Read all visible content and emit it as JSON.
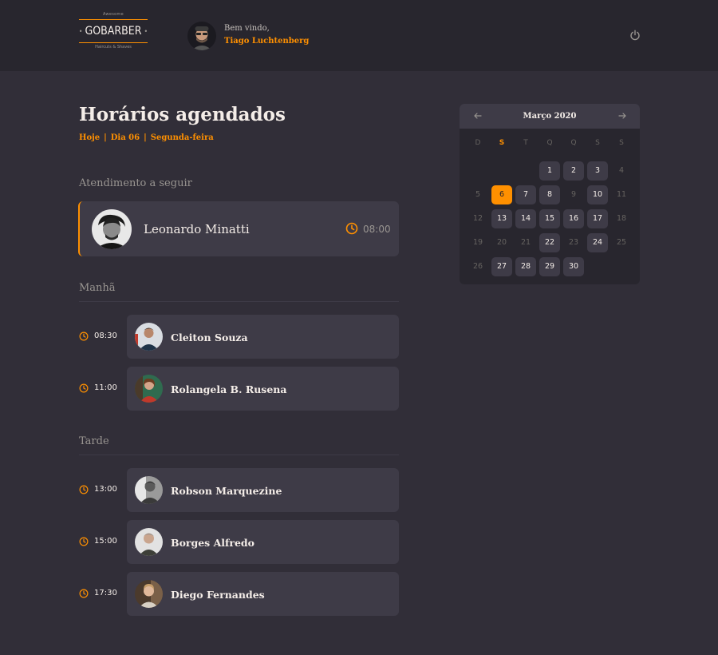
{
  "header": {
    "logo_top": "Awesome",
    "logo_brand": "GOBARBER",
    "logo_bottom": "Haircuts & Shaves",
    "welcome": "Bem vindo,",
    "user_name": "Tiago Luchtenberg",
    "power_icon": "power-icon"
  },
  "schedule": {
    "title": "Horários agendados",
    "sub_today": "Hoje",
    "sub_day": "Dia 06",
    "sub_weekday": "Segunda-feira",
    "next_label": "Atendimento a seguir",
    "next": {
      "name": "Leonardo Minatti",
      "time": "08:00"
    },
    "morning_label": "Manhã",
    "afternoon_label": "Tarde",
    "morning": [
      {
        "time": "08:30",
        "name": "Cleiton Souza"
      },
      {
        "time": "11:00",
        "name": "Rolangela B. Rusena"
      }
    ],
    "afternoon": [
      {
        "time": "13:00",
        "name": "Robson Marquezine"
      },
      {
        "time": "15:00",
        "name": "Borges Alfredo"
      },
      {
        "time": "17:30",
        "name": "Diego Fernandes"
      }
    ]
  },
  "calendar": {
    "month": "Março 2020",
    "prev_icon": "arrow-left-icon",
    "next_icon": "arrow-right-icon",
    "weekdays": [
      "D",
      "S",
      "T",
      "Q",
      "Q",
      "S",
      "S"
    ],
    "active_weekday_index": 1,
    "selected_day": 6,
    "available_days": [
      1,
      2,
      3,
      6,
      7,
      8,
      10,
      13,
      14,
      15,
      16,
      17,
      22,
      24,
      27,
      28,
      29,
      30
    ],
    "days_unavailable": [
      4,
      5,
      9,
      11,
      12,
      18,
      19,
      20,
      21,
      23,
      25,
      26
    ]
  },
  "colors": {
    "accent": "#ff9000",
    "background": "#312e38",
    "card": "#3e3b47",
    "header": "#28262e"
  }
}
